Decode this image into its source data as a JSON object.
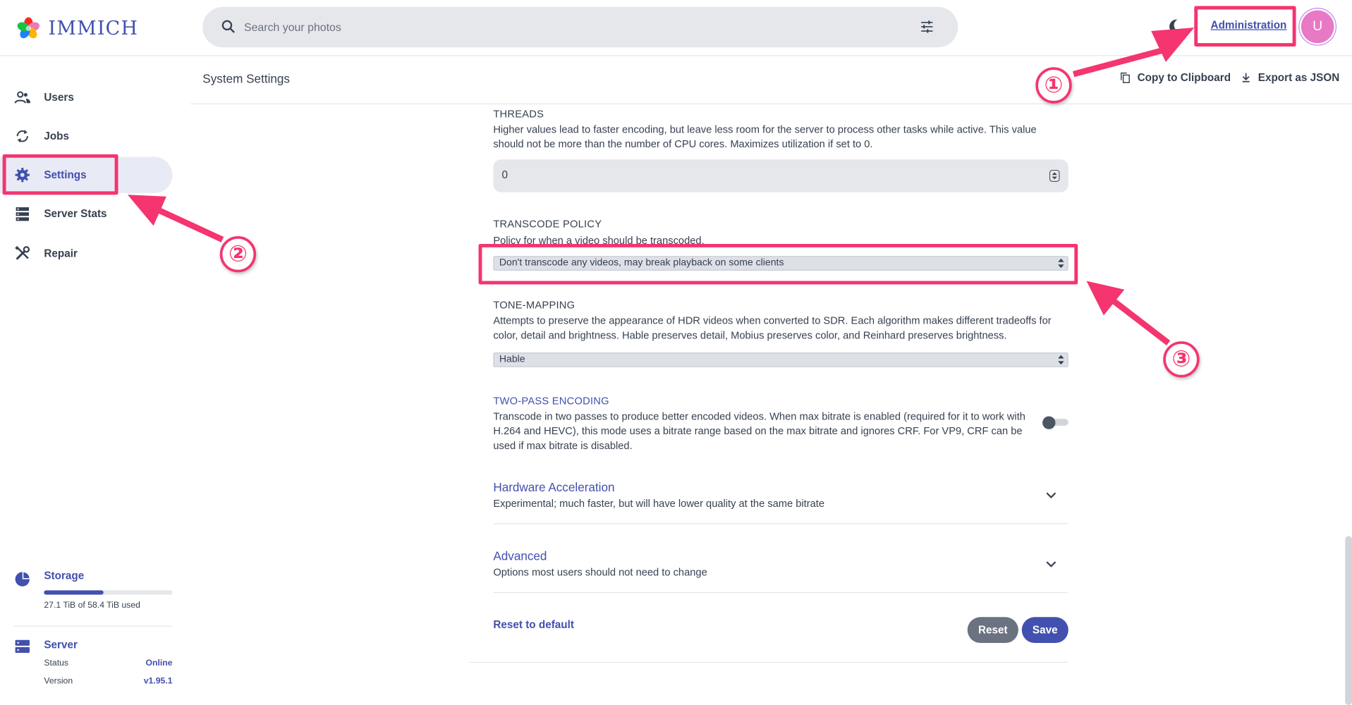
{
  "app": {
    "logo_text": "IMMICH"
  },
  "header": {
    "search_placeholder": "Search your photos",
    "admin_link": "Administration",
    "avatar_initial": "U"
  },
  "sidebar": {
    "items": [
      {
        "label": "Users",
        "icon": "users-icon"
      },
      {
        "label": "Jobs",
        "icon": "sync-icon"
      },
      {
        "label": "Settings",
        "icon": "gear-icon",
        "active": true
      },
      {
        "label": "Server Stats",
        "icon": "server-icon"
      },
      {
        "label": "Repair",
        "icon": "tools-icon"
      }
    ],
    "storage": {
      "label": "Storage",
      "usage_text": "27.1 TiB of 58.4 TiB used",
      "used_fraction": 0.464
    },
    "server": {
      "label": "Server",
      "status_label": "Status",
      "status_value": "Online",
      "version_label": "Version",
      "version_value": "v1.95.1"
    }
  },
  "page": {
    "title": "System Settings",
    "copy_button": "Copy to Clipboard",
    "export_button": "Export as JSON"
  },
  "settings": {
    "threads": {
      "title": "THREADS",
      "description": "Higher values lead to faster encoding, but leave less room for the server to process other tasks while active. This value should not be more than the number of CPU cores. Maximizes utilization if set to 0.",
      "value": "0"
    },
    "transcode_policy": {
      "title": "TRANSCODE POLICY",
      "description": "Policy for when a video should be transcoded.",
      "selected": "Don't transcode any videos, may break playback on some clients"
    },
    "tone_mapping": {
      "title": "TONE-MAPPING",
      "description": "Attempts to preserve the appearance of HDR videos when converted to SDR. Each algorithm makes different tradeoffs for color, detail and brightness. Hable preserves detail, Mobius preserves color, and Reinhard preserves brightness.",
      "selected": "Hable"
    },
    "two_pass": {
      "title": "TWO-PASS ENCODING",
      "description": "Transcode in two passes to produce better encoded videos. When max bitrate is enabled (required for it to work with H.264 and HEVC), this mode uses a bitrate range based on the max bitrate and ignores CRF. For VP9, CRF can be used if max bitrate is disabled.",
      "enabled": false
    },
    "hardware_acceleration": {
      "title": "Hardware Acceleration",
      "description": "Experimental; much faster, but will have lower quality at the same bitrate"
    },
    "advanced": {
      "title": "Advanced",
      "description": "Options most users should not need to change"
    },
    "reset_default": "Reset to default",
    "reset_button": "Reset",
    "save_button": "Save"
  },
  "annotations": {
    "step1": "①",
    "step2": "②",
    "step3": "③",
    "color": "#f4356f"
  }
}
